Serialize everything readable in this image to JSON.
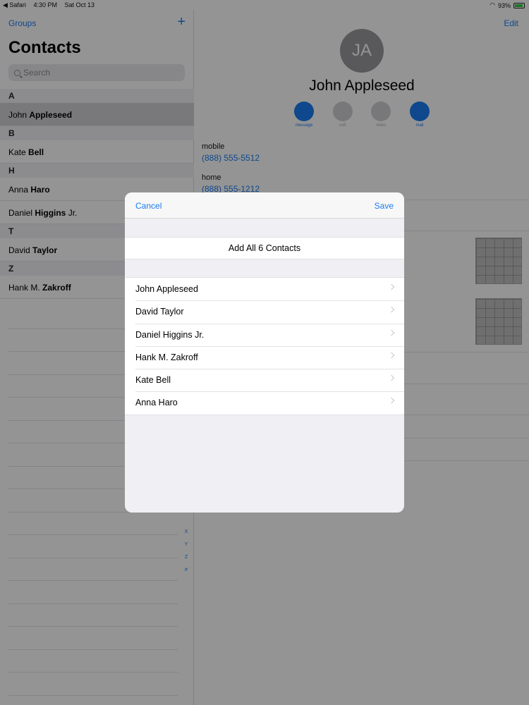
{
  "statusbar": {
    "back": "◀ Safari",
    "time": "4:30 PM",
    "date": "Sat Oct 13",
    "battery": "93%"
  },
  "left": {
    "groups": "Groups",
    "plus": "+",
    "title": "Contacts",
    "search_placeholder": "Search",
    "sections": [
      {
        "letter": "A",
        "rows": [
          {
            "first": "John ",
            "last": "Appleseed",
            "selected": true
          }
        ]
      },
      {
        "letter": "B",
        "rows": [
          {
            "first": "Kate ",
            "last": "Bell"
          }
        ]
      },
      {
        "letter": "H",
        "rows": [
          {
            "first": "Anna ",
            "last": "Haro"
          },
          {
            "first": "Daniel ",
            "last": "Higgins",
            "suffix": " Jr."
          }
        ]
      },
      {
        "letter": "T",
        "rows": [
          {
            "first": "David ",
            "last": "Taylor"
          }
        ]
      },
      {
        "letter": "Z",
        "rows": [
          {
            "first": "Hank M. ",
            "last": "Zakroff"
          }
        ]
      }
    ],
    "index_letters": [
      "X",
      "Y",
      "Z",
      "#"
    ]
  },
  "right": {
    "edit": "Edit",
    "initials": "JA",
    "name": "John Appleseed",
    "actions": [
      {
        "label": "message",
        "icon": "message-icon",
        "enabled": true
      },
      {
        "label": "call",
        "icon": "phone-icon",
        "enabled": false
      },
      {
        "label": "video",
        "icon": "video-icon",
        "enabled": false
      },
      {
        "label": "mail",
        "icon": "mail-icon",
        "enabled": true
      }
    ],
    "mobile_label": "mobile",
    "mobile_value": "(888) 555-5512",
    "home_label": "home",
    "home_value": "(888) 555-1212"
  },
  "modal": {
    "cancel": "Cancel",
    "save": "Save",
    "add_all": "Add All 6 Contacts",
    "contacts": [
      "John Appleseed",
      "David Taylor",
      "Daniel Higgins Jr.",
      "Hank M. Zakroff",
      "Kate Bell",
      "Anna Haro"
    ]
  },
  "colors": {
    "accent": "#1a7cf2",
    "overlay": "rgba(0,0,0,0.42)"
  }
}
